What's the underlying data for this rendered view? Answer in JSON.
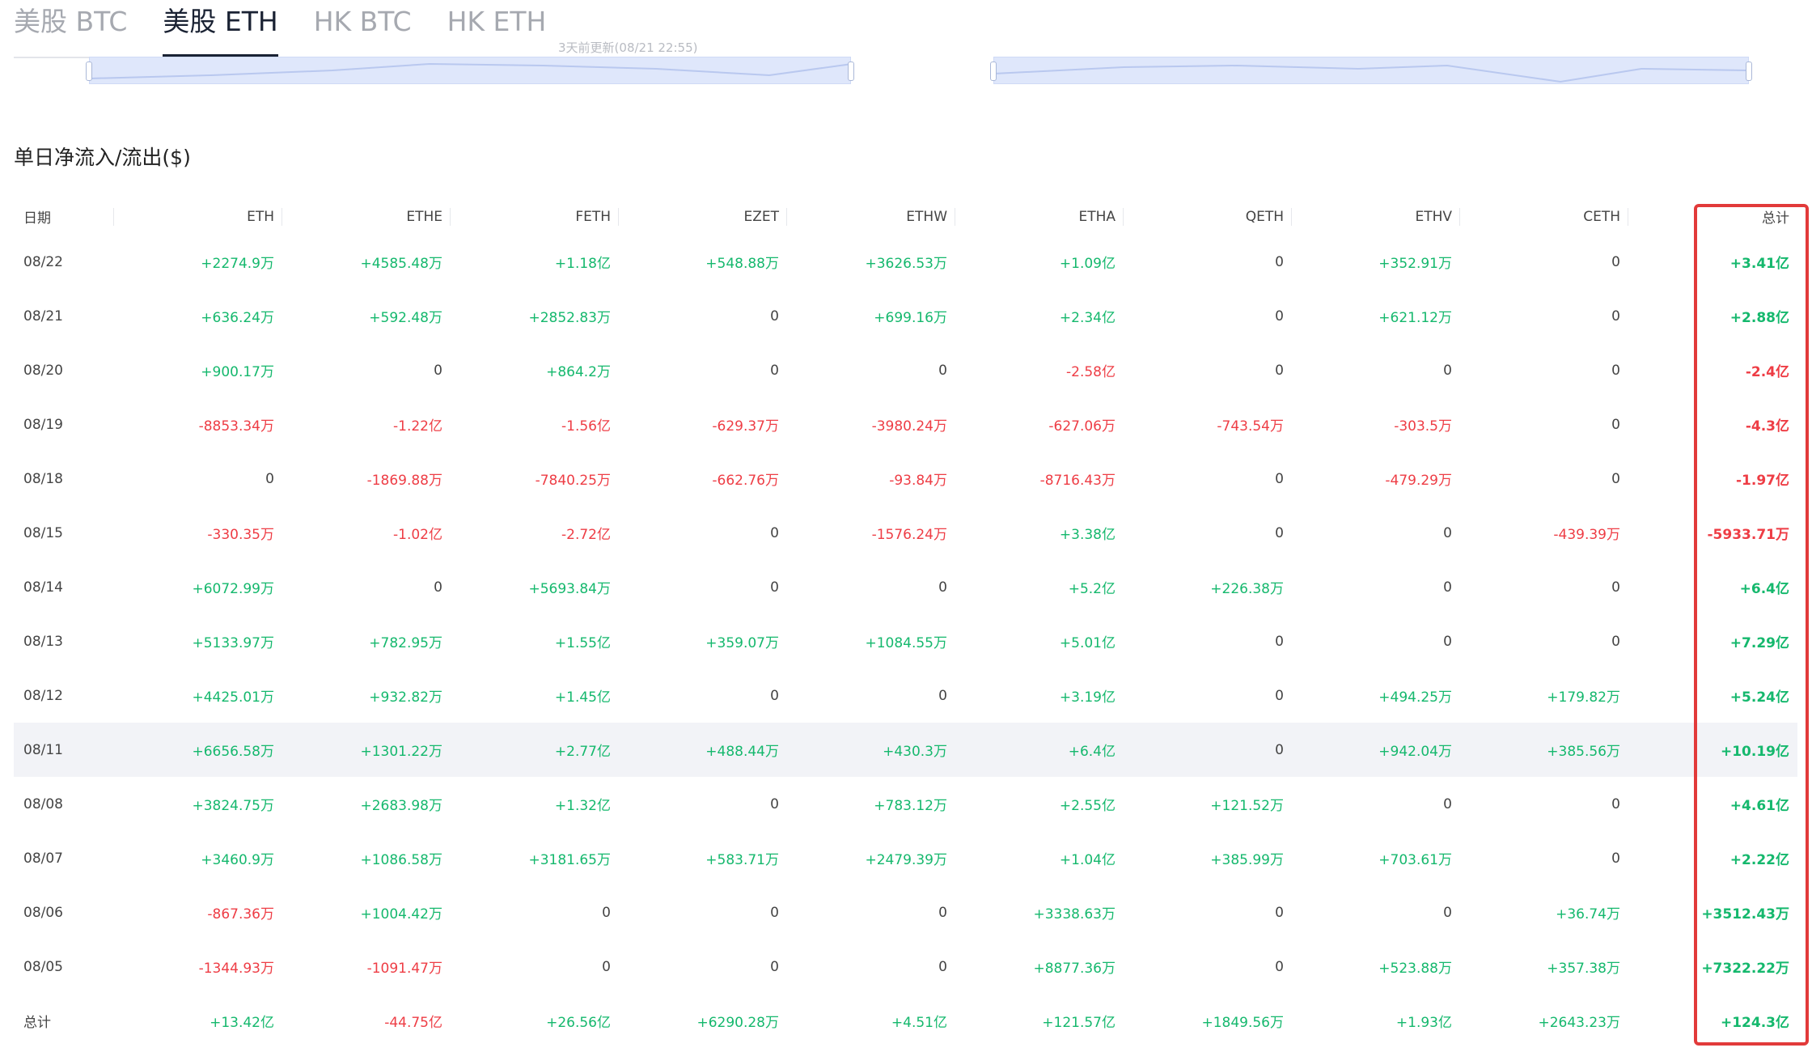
{
  "tabs": [
    {
      "label": "美股 BTC",
      "active": false
    },
    {
      "label": "美股 ETH",
      "active": true
    },
    {
      "label": "HK BTC",
      "active": false
    },
    {
      "label": "HK ETH",
      "active": false
    }
  ],
  "updated_text": "3天前更新(08/21 22:55)",
  "section_title": "单日净流入/流出($)",
  "table": {
    "columns": [
      "日期",
      "ETH",
      "ETHE",
      "FETH",
      "EZET",
      "ETHW",
      "ETHA",
      "QETH",
      "ETHV",
      "CETH",
      "总计"
    ],
    "rows": [
      [
        "08/22",
        "+2274.9万",
        "+4585.48万",
        "+1.18亿",
        "+548.88万",
        "+3626.53万",
        "+1.09亿",
        "0",
        "+352.91万",
        "0",
        "+3.41亿"
      ],
      [
        "08/21",
        "+636.24万",
        "+592.48万",
        "+2852.83万",
        "0",
        "+699.16万",
        "+2.34亿",
        "0",
        "+621.12万",
        "0",
        "+2.88亿"
      ],
      [
        "08/20",
        "+900.17万",
        "0",
        "+864.2万",
        "0",
        "0",
        "-2.58亿",
        "0",
        "0",
        "0",
        "-2.4亿"
      ],
      [
        "08/19",
        "-8853.34万",
        "-1.22亿",
        "-1.56亿",
        "-629.37万",
        "-3980.24万",
        "-627.06万",
        "-743.54万",
        "-303.5万",
        "0",
        "-4.3亿"
      ],
      [
        "08/18",
        "0",
        "-1869.88万",
        "-7840.25万",
        "-662.76万",
        "-93.84万",
        "-8716.43万",
        "0",
        "-479.29万",
        "0",
        "-1.97亿"
      ],
      [
        "08/15",
        "-330.35万",
        "-1.02亿",
        "-2.72亿",
        "0",
        "-1576.24万",
        "+3.38亿",
        "0",
        "0",
        "-439.39万",
        "-5933.71万"
      ],
      [
        "08/14",
        "+6072.99万",
        "0",
        "+5693.84万",
        "0",
        "0",
        "+5.2亿",
        "+226.38万",
        "0",
        "0",
        "+6.4亿"
      ],
      [
        "08/13",
        "+5133.97万",
        "+782.95万",
        "+1.55亿",
        "+359.07万",
        "+1084.55万",
        "+5.01亿",
        "0",
        "0",
        "0",
        "+7.29亿"
      ],
      [
        "08/12",
        "+4425.01万",
        "+932.82万",
        "+1.45亿",
        "0",
        "0",
        "+3.19亿",
        "0",
        "+494.25万",
        "+179.82万",
        "+5.24亿"
      ],
      [
        "08/11",
        "+6656.58万",
        "+1301.22万",
        "+2.77亿",
        "+488.44万",
        "+430.3万",
        "+6.4亿",
        "0",
        "+942.04万",
        "+385.56万",
        "+10.19亿"
      ],
      [
        "08/08",
        "+3824.75万",
        "+2683.98万",
        "+1.32亿",
        "0",
        "+783.12万",
        "+2.55亿",
        "+121.52万",
        "0",
        "0",
        "+4.61亿"
      ],
      [
        "08/07",
        "+3460.9万",
        "+1086.58万",
        "+3181.65万",
        "+583.71万",
        "+2479.39万",
        "+1.04亿",
        "+385.99万",
        "+703.61万",
        "0",
        "+2.22亿"
      ],
      [
        "08/06",
        "-867.36万",
        "+1004.42万",
        "0",
        "0",
        "0",
        "+3338.63万",
        "0",
        "0",
        "+36.74万",
        "+3512.43万"
      ],
      [
        "08/05",
        "-1344.93万",
        "-1091.47万",
        "0",
        "0",
        "0",
        "+8877.36万",
        "0",
        "+523.88万",
        "+357.38万",
        "+7322.22万"
      ],
      [
        "总计",
        "+13.42亿",
        "-44.75亿",
        "+26.56亿",
        "+6290.28万",
        "+4.51亿",
        "+121.57亿",
        "+1849.56万",
        "+1.93亿",
        "+2643.23万",
        "+124.3亿"
      ]
    ],
    "highlighted_row": 9
  },
  "colors": {
    "positive": "#15b86d",
    "negative": "#ee3d45",
    "highlight_box": "#e23a3a"
  }
}
